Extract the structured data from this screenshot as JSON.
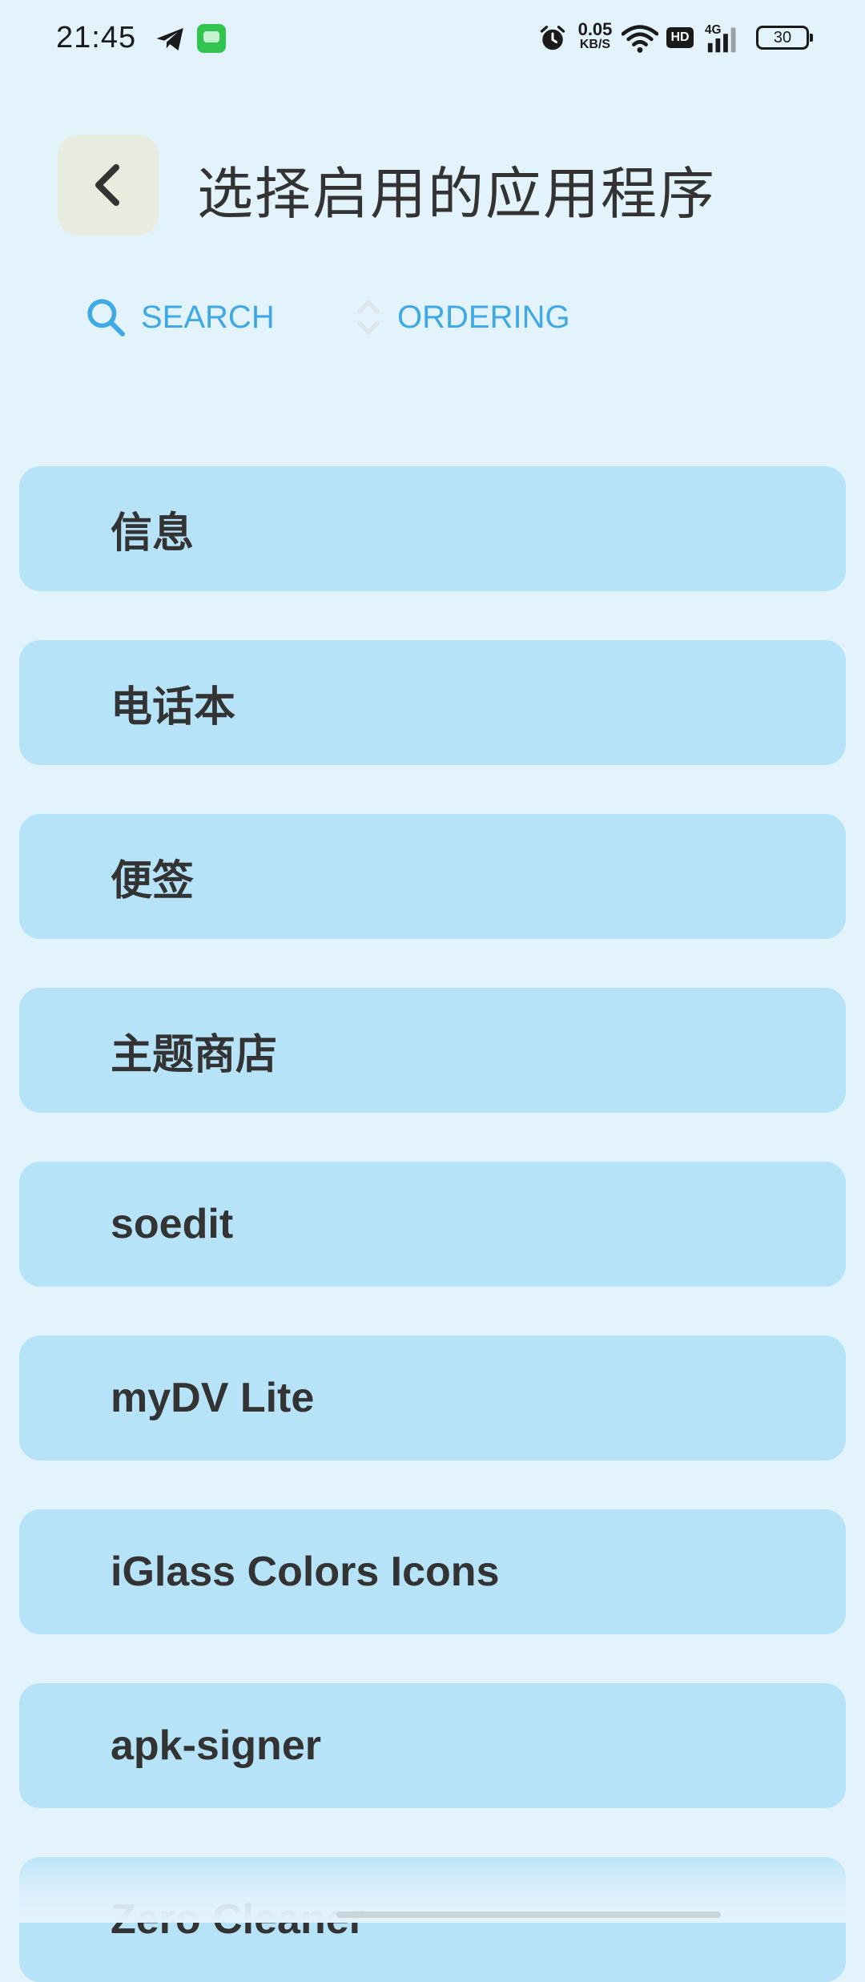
{
  "status_bar": {
    "time": "21:45",
    "net_speed_value": "0.05",
    "net_speed_unit": "KB/S",
    "hd_badge": "HD",
    "signal_label": "4G",
    "battery": "30",
    "icons": [
      "telegram-icon",
      "messages-icon",
      "alarm-icon",
      "wifi-icon",
      "hd-icon",
      "signal-icon",
      "battery-icon"
    ]
  },
  "header": {
    "title": "选择启用的应用程序",
    "back_icon": "chevron-left-icon"
  },
  "toolbar": {
    "search_label": "SEARCH",
    "ordering_label": "ORDERING"
  },
  "apps": [
    {
      "label": "信息"
    },
    {
      "label": "电话本"
    },
    {
      "label": "便签"
    },
    {
      "label": "主题商店"
    },
    {
      "label": "soedit"
    },
    {
      "label": "myDV Lite"
    },
    {
      "label": "iGlass Colors Icons"
    },
    {
      "label": "apk-signer"
    },
    {
      "label": "Zero Cleaner"
    }
  ],
  "colors": {
    "background": "#e3f3fc",
    "item_background": "#b6e3f8",
    "accent": "#3fa9e6",
    "back_button": "#e8ecdf"
  }
}
